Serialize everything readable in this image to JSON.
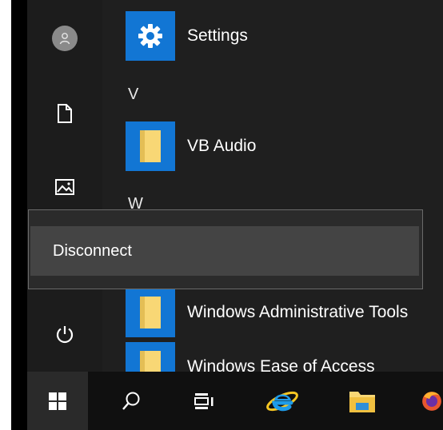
{
  "start_menu": {
    "left_rail": {
      "items": [
        {
          "name": "user",
          "icon": "user-avatar-icon"
        },
        {
          "name": "documents",
          "icon": "document-icon"
        },
        {
          "name": "pictures",
          "icon": "pictures-icon"
        },
        {
          "name": "power",
          "icon": "power-icon"
        }
      ]
    },
    "app_list": {
      "settings": {
        "label": "Settings",
        "icon": "gear-icon"
      },
      "section_v": {
        "letter": "V"
      },
      "vb_audio": {
        "label": "VB Audio",
        "icon": "folder-icon"
      },
      "section_w": {
        "letter": "W"
      },
      "windows_admin_tools": {
        "label": "Windows Administrative Tools",
        "icon": "folder-icon"
      },
      "windows_ease_of_access": {
        "label": "Windows Ease of Access",
        "icon": "folder-icon"
      }
    },
    "tile_color": "#1276d4",
    "folder_color": "#f8d775"
  },
  "context_menu": {
    "items": [
      {
        "label": "Disconnect"
      }
    ]
  },
  "taskbar": {
    "items": [
      {
        "name": "start",
        "icon": "windows-logo-icon"
      },
      {
        "name": "search",
        "icon": "search-icon"
      },
      {
        "name": "task-view",
        "icon": "task-view-icon"
      },
      {
        "name": "internet-explorer",
        "icon": "internet-explorer-icon"
      },
      {
        "name": "file-explorer",
        "icon": "file-explorer-icon"
      },
      {
        "name": "firefox",
        "icon": "firefox-icon"
      }
    ]
  }
}
